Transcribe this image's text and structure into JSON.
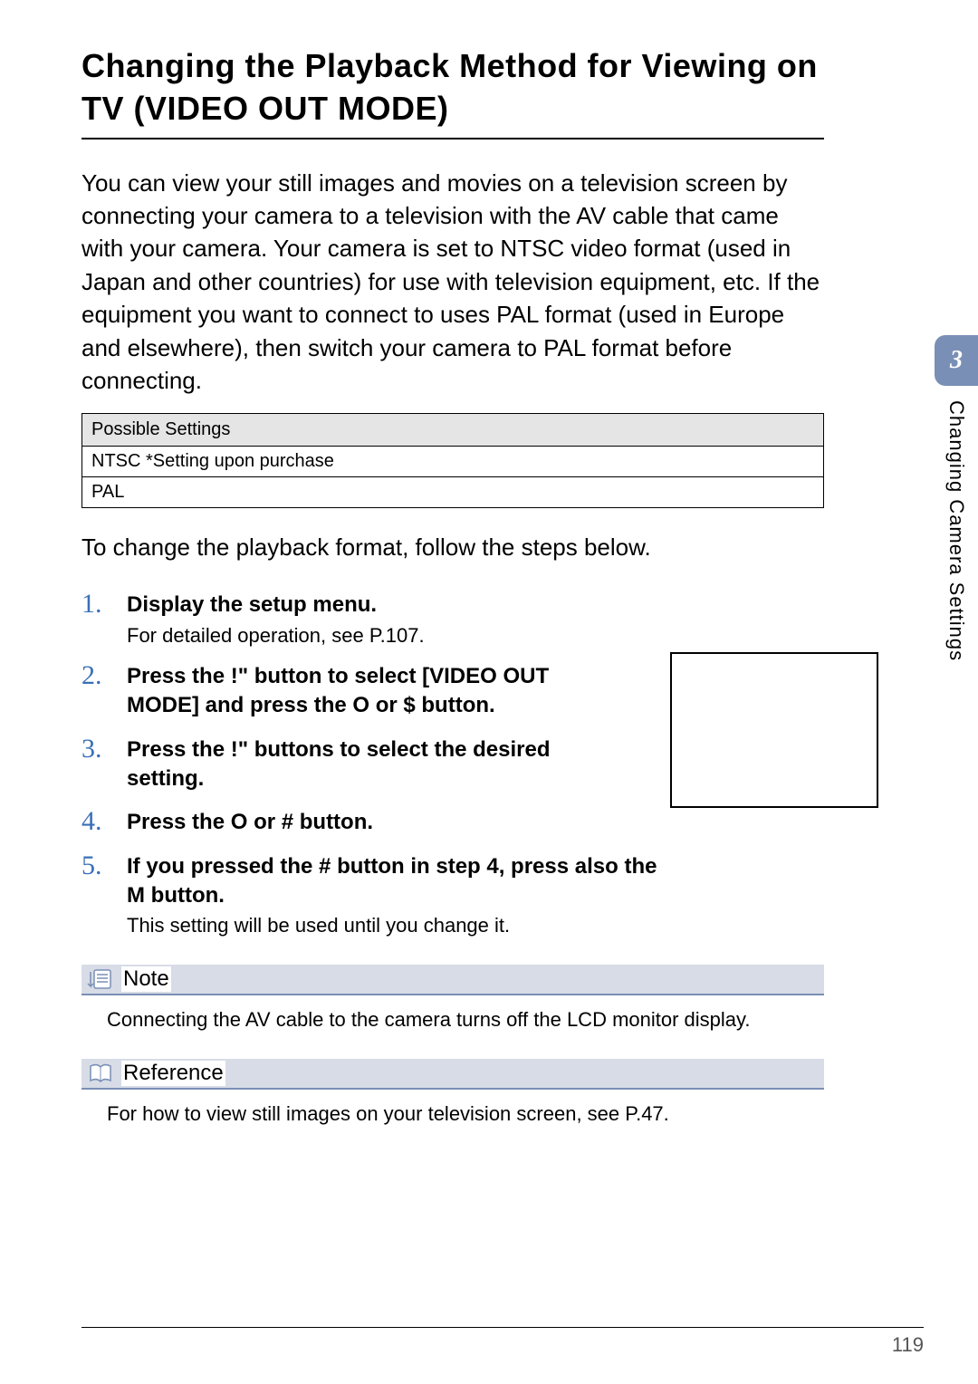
{
  "title": "Changing the Playback Method for Viewing on TV (VIDEO OUT MODE)",
  "intro": "You can view your still images and movies on a television screen by connecting your camera to a television with the AV cable that came with your camera.\nYour camera is set to NTSC video format (used in Japan and other countries) for use with television equipment, etc. If the equipment you want to connect to uses PAL format (used in Europe and elsewhere), then switch your camera to PAL format before connecting.",
  "settings": {
    "header": "Possible Settings",
    "rows": [
      "NTSC  *Setting upon purchase",
      "PAL"
    ]
  },
  "subtitle": "To change the playback format, follow the steps below.",
  "steps": [
    {
      "num": "1.",
      "main": "Display the setup menu.",
      "sub": "For detailed operation, see P.107."
    },
    {
      "num": "2.",
      "main": "Press the !\"  button to select [VIDEO OUT MODE] and press the O  or $ button."
    },
    {
      "num": "3.",
      "main": "Press the !\"  buttons to select the desired setting."
    },
    {
      "num": "4.",
      "main": "Press the O  or # button."
    },
    {
      "num": "5.",
      "main": "If you pressed the # button in step 4, press also the M      button.",
      "sub": "This setting will be used until you change it."
    }
  ],
  "note": {
    "label": "Note",
    "body": "Connecting the AV cable to the camera turns off the LCD monitor display."
  },
  "reference": {
    "label": "Reference",
    "body": "For how to view still images on your television screen, see P.47."
  },
  "sidebar": {
    "chapter_num": "3",
    "chapter_label": "Changing Camera Settings"
  },
  "page_number": "119"
}
